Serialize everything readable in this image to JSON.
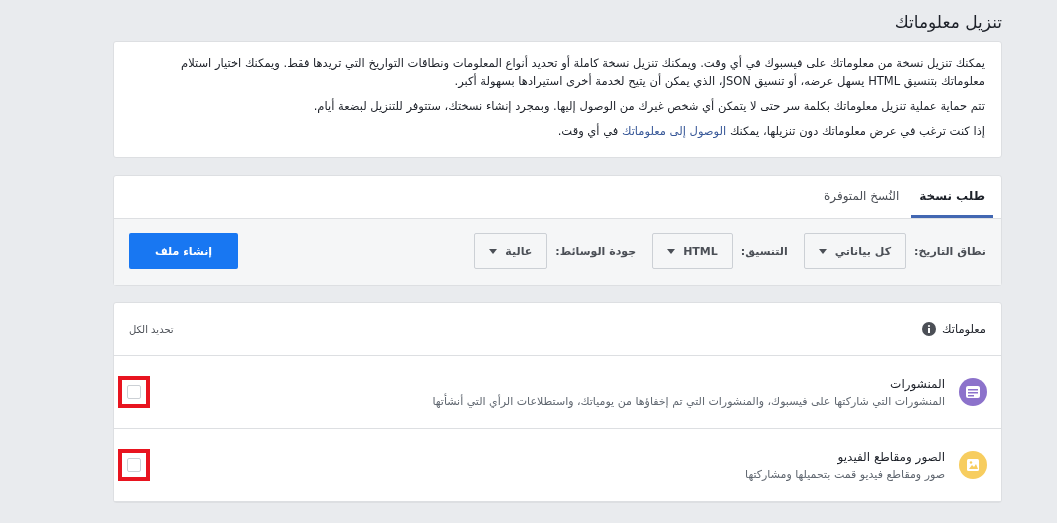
{
  "page_title": "تنزيل معلوماتك",
  "intro": {
    "paragraphs": [
      {
        "text": "يمكنك تنزيل نسخة من معلوماتك على فيسبوك في أي وقت. ويمكنك تنزيل نسخة كاملة أو تحديد أنواع المعلومات ونطاقات التواريخ التي تريدها فقط. ويمكنك اختيار استلام معلوماتك بتنسيق HTML يسهل عرضه، أو تنسيق JSON، الذي يمكن أن يتيح لخدمة أخرى استيرادها بسهولة أكبر."
      },
      {
        "text": "تتم حماية عملية تنزيل معلوماتك بكلمة سر حتى لا يتمكن أي شخص غيرك من الوصول إليها. وبمجرد إنشاء نسختك، ستتوفر للتنزيل لبضعة أيام."
      },
      {
        "text": "إذا كنت ترغب في عرض معلوماتك دون تنزيلها، يمكنك ",
        "link": "الوصول إلى معلوماتك",
        "after": " في أي وقت."
      }
    ]
  },
  "tabs": [
    {
      "label": "طلب نسخة",
      "selected": true
    },
    {
      "label": "النُسخ المتوفرة",
      "selected": false
    }
  ],
  "options": [
    {
      "label": "نطاق التاريخ:",
      "value": "كل بياناتي"
    },
    {
      "label": "التنسيق:",
      "value": "HTML"
    },
    {
      "label": "جودة الوسائط:",
      "value": "عالية"
    }
  ],
  "create_button": "إنشاء ملف",
  "info": {
    "title": "معلوماتك",
    "select_all": "تحديد الكل",
    "items": [
      {
        "kind": "posts",
        "title": "المنشورات",
        "description": "المنشورات التي شاركتها على فيسبوك، والمنشورات التي تم إخفاؤها من يومياتك، واستطلاعات الرأي التي أنشأتها",
        "checked": false,
        "highlighted": true
      },
      {
        "kind": "photos",
        "title": "الصور ومقاطع الفيديو",
        "description": "صور ومقاطع فيديو قمت بتحميلها ومشاركتها",
        "checked": false,
        "highlighted": true
      }
    ]
  }
}
